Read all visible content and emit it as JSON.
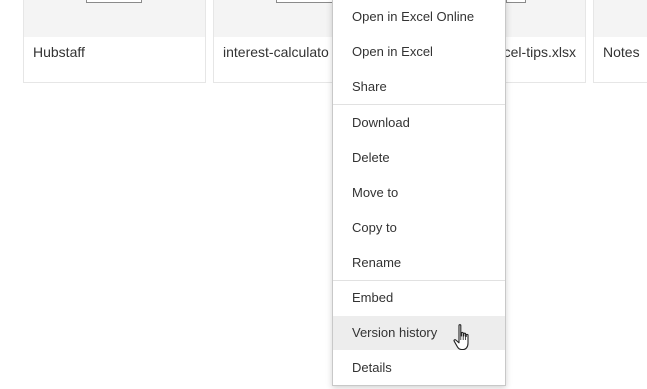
{
  "files": [
    {
      "name": "Hubstaff"
    },
    {
      "name": "interest-calculato"
    },
    {
      "name": "cel-tips.xlsx"
    },
    {
      "name": "Notes"
    }
  ],
  "context_menu": {
    "items": [
      {
        "label": "Open in Excel Online"
      },
      {
        "label": "Open in Excel"
      },
      {
        "label": "Share"
      },
      {
        "label": "Download"
      },
      {
        "label": "Delete"
      },
      {
        "label": "Move to"
      },
      {
        "label": "Copy to"
      },
      {
        "label": "Rename"
      },
      {
        "label": "Embed"
      },
      {
        "label": "Version history",
        "hovered": true
      },
      {
        "label": "Details"
      }
    ]
  },
  "cursor": {
    "icon": "hand-pointer-icon"
  },
  "colors": {
    "text": "#333333",
    "hover_background": "#ededed",
    "thumbnail_background": "#f4f4f4",
    "separator": "#e1e1e1"
  }
}
